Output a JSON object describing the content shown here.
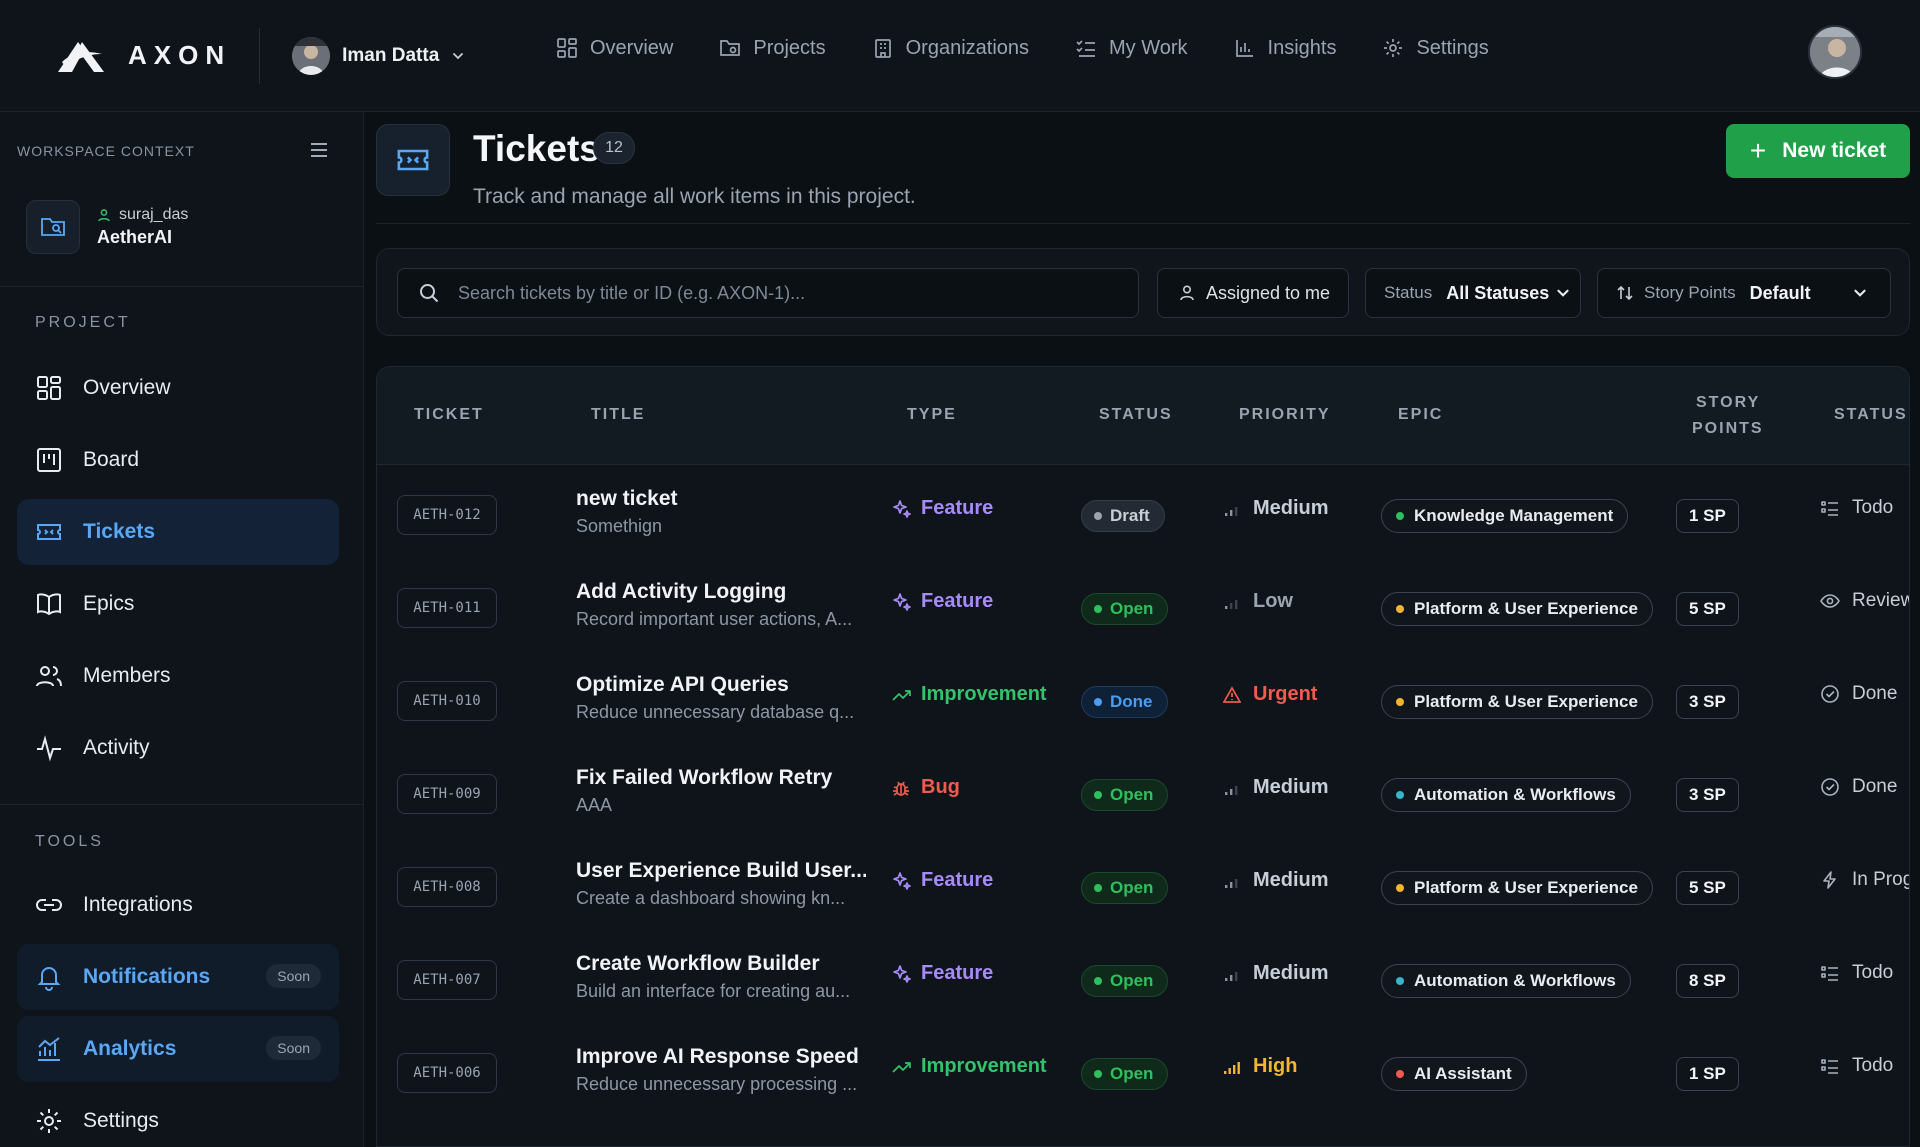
{
  "topbar": {
    "brand": "AXON",
    "user": "Iman Datta",
    "nav": [
      {
        "label": "Overview",
        "icon": "grid-icon"
      },
      {
        "label": "Projects",
        "icon": "folder-icon"
      },
      {
        "label": "Organizations",
        "icon": "building-icon"
      },
      {
        "label": "My Work",
        "icon": "checklist-icon"
      },
      {
        "label": "Insights",
        "icon": "bar-chart-icon"
      },
      {
        "label": "Settings",
        "icon": "gear-icon"
      }
    ]
  },
  "sidebar": {
    "context_label": "WORKSPACE CONTEXT",
    "workspace_user": "suraj_das",
    "workspace_name": "AetherAI",
    "project_label": "PROJECT",
    "tools_label": "TOOLS",
    "project_items": [
      {
        "label": "Overview"
      },
      {
        "label": "Board"
      },
      {
        "label": "Tickets"
      },
      {
        "label": "Epics"
      },
      {
        "label": "Members"
      },
      {
        "label": "Activity"
      }
    ],
    "tool_items": [
      {
        "label": "Integrations",
        "badge": ""
      },
      {
        "label": "Notifications",
        "badge": "Soon"
      },
      {
        "label": "Analytics",
        "badge": "Soon"
      },
      {
        "label": "Settings",
        "badge": ""
      }
    ]
  },
  "header": {
    "title": "Tickets",
    "count": "12",
    "subtitle": "Track and manage all work items in this project.",
    "new_button": "New ticket"
  },
  "filters": {
    "search_placeholder": "Search tickets by title or ID (e.g. AXON-1)...",
    "assigned": "Assigned to me",
    "status_label": "Status",
    "status_value": "All Statuses",
    "sp_label": "Story Points",
    "sp_value": "Default"
  },
  "table": {
    "columns": {
      "ticket": "TICKET",
      "title": "TITLE",
      "type": "TYPE",
      "status": "STATUS",
      "priority": "PRIORITY",
      "epic": "EPIC",
      "story_points_1": "STORY",
      "story_points_2": "POINTS",
      "status2": "STATUS"
    },
    "rows": [
      {
        "id": "AETH-012",
        "title": "new ticket",
        "desc": "Somethign",
        "type": "Feature",
        "status": "Draft",
        "priority": "Medium",
        "epic": "Knowledge Management",
        "sp": "1 SP",
        "status2": "Todo"
      },
      {
        "id": "AETH-011",
        "title": "Add Activity Logging",
        "desc": "Record important user actions, A...",
        "type": "Feature",
        "status": "Open",
        "priority": "Low",
        "epic": "Platform & User Experience",
        "sp": "5 SP",
        "status2": "Review"
      },
      {
        "id": "AETH-010",
        "title": "Optimize API Queries",
        "desc": "Reduce unnecessary database q...",
        "type": "Improvement",
        "status": "Done",
        "priority": "Urgent",
        "epic": "Platform & User Experience",
        "sp": "3 SP",
        "status2": "Done"
      },
      {
        "id": "AETH-009",
        "title": "Fix Failed Workflow Retry",
        "desc": "AAA",
        "type": "Bug",
        "status": "Open",
        "priority": "Medium",
        "epic": "Automation & Workflows",
        "sp": "3 SP",
        "status2": "Done"
      },
      {
        "id": "AETH-008",
        "title": "User Experience Build User...",
        "desc": "Create a dashboard showing kn...",
        "type": "Feature",
        "status": "Open",
        "priority": "Medium",
        "epic": "Platform & User Experience",
        "sp": "5 SP",
        "status2": "In Prog"
      },
      {
        "id": "AETH-007",
        "title": "Create Workflow Builder",
        "desc": "Build an interface for creating au...",
        "type": "Feature",
        "status": "Open",
        "priority": "Medium",
        "epic": "Automation & Workflows",
        "sp": "8 SP",
        "status2": "Todo"
      },
      {
        "id": "AETH-006",
        "title": "Improve AI Response Speed",
        "desc": "Reduce unnecessary processing ...",
        "type": "Improvement",
        "status": "Open",
        "priority": "High",
        "epic": "AI Assistant",
        "sp": "1 SP",
        "status2": "Todo"
      }
    ]
  },
  "colors": {
    "accent": "#5aa8f5",
    "primary_button": "#20a049",
    "feature": "#a78bfa",
    "improvement": "#34c26a",
    "bug": "#f05a4f",
    "urgent": "#f05a4f",
    "high": "#f2b431",
    "open": "#2fbf5f",
    "done": "#4a9df0"
  }
}
